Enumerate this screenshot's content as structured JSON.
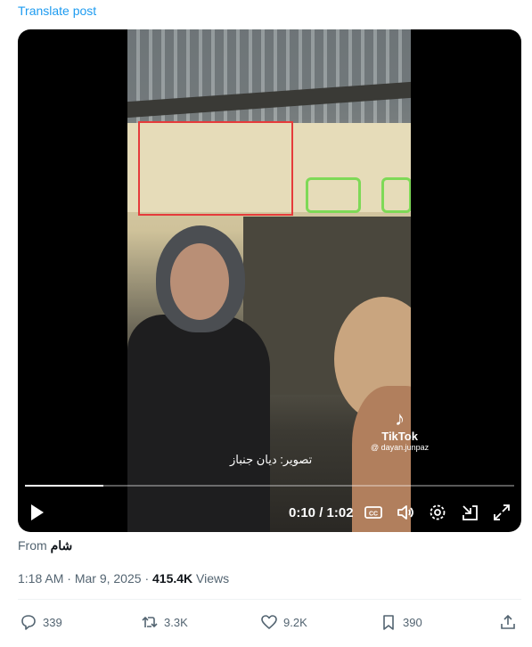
{
  "translate_label": "Translate post",
  "video": {
    "watermark_brand": "TikTok",
    "watermark_handle": "@ dayan.junpaz",
    "caption": "تصوير: ديان جنباز",
    "time": "0:10 / 1:02",
    "progress_fraction": 0.16
  },
  "post": {
    "from_label": "From",
    "source": "شام",
    "time": "1:18 AM",
    "date": "Mar 9, 2025",
    "views": "415.4K",
    "views_label": "Views"
  },
  "actions": {
    "replies": "339",
    "reposts": "3.3K",
    "likes": "9.2K",
    "bookmarks": "390"
  },
  "colors": {
    "link": "#1d9bf0",
    "annot_red": "#e53b3b",
    "annot_green": "#7ed957"
  }
}
